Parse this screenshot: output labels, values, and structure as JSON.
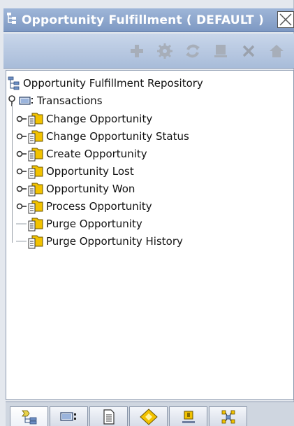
{
  "window": {
    "title": "Opportunity Fulfillment ( DEFAULT )"
  },
  "toolbar": {
    "buttons": [
      {
        "name": "add",
        "icon": "plus-icon",
        "enabled": false
      },
      {
        "name": "details",
        "icon": "gear-icon",
        "enabled": false
      },
      {
        "name": "refresh",
        "icon": "refresh-icon",
        "enabled": false
      },
      {
        "name": "save",
        "icon": "save-icon",
        "enabled": false
      },
      {
        "name": "delete",
        "icon": "delete-icon",
        "enabled": false
      },
      {
        "name": "go",
        "icon": "house-icon",
        "enabled": false
      }
    ]
  },
  "tree": {
    "root": "Opportunity Fulfillment Repository",
    "group": "Transactions",
    "items": [
      {
        "label": "Change Opportunity",
        "expandable": true
      },
      {
        "label": "Change Opportunity Status",
        "expandable": true
      },
      {
        "label": "Create Opportunity",
        "expandable": true
      },
      {
        "label": "Opportunity Lost",
        "expandable": true
      },
      {
        "label": "Opportunity Won",
        "expandable": true
      },
      {
        "label": "Process Opportunity",
        "expandable": true
      },
      {
        "label": "Purge Opportunity",
        "expandable": false
      },
      {
        "label": "Purge Opportunity History",
        "expandable": false
      }
    ]
  },
  "tabs": [
    {
      "icon": "tree-icon",
      "active": true
    },
    {
      "icon": "list-icon",
      "active": false
    },
    {
      "icon": "document-icon",
      "active": false
    },
    {
      "icon": "diamond-icon",
      "active": false
    },
    {
      "icon": "alert-icon",
      "active": false
    },
    {
      "icon": "network-icon",
      "active": false
    }
  ],
  "colors": {
    "title_bar": "#8aa3cb",
    "toolbar": "#b8c8e1",
    "folder": "#f2c200"
  }
}
